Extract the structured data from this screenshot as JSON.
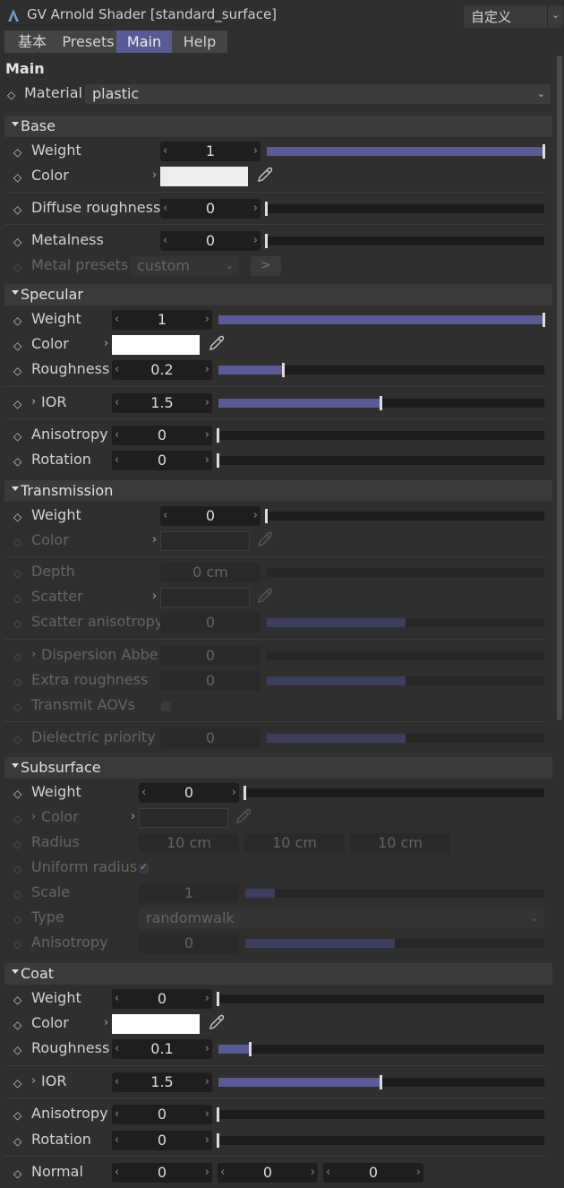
{
  "title": "GV Arnold Shader [standard_surface]",
  "preset": "自定义",
  "tabs": [
    "基本",
    "Presets",
    "Main",
    "Help"
  ],
  "main_heading": "Main",
  "material": {
    "label": "Material",
    "value": "plastic"
  },
  "base": {
    "header": "Base",
    "weight": {
      "label": "Weight",
      "value": "1",
      "level": 1.0
    },
    "color": {
      "label": "Color",
      "hex": "#eeeeee"
    },
    "diffuse_roughness": {
      "label": "Diffuse roughness",
      "value": "0",
      "level": 0.0
    },
    "metalness": {
      "label": "Metalness",
      "value": "0",
      "level": 0.0
    },
    "metal_presets": {
      "label": "Metal presets",
      "value": "custom",
      "button": ">"
    }
  },
  "specular": {
    "header": "Specular",
    "weight": {
      "label": "Weight",
      "value": "1",
      "level": 1.0
    },
    "color": {
      "label": "Color",
      "hex": "#ffffff"
    },
    "roughness": {
      "label": "Roughness",
      "value": "0.2",
      "level": 0.2
    },
    "ior": {
      "label": "IOR",
      "value": "1.5",
      "level": 0.5
    },
    "anisotropy": {
      "label": "Anisotropy",
      "value": "0",
      "level": 0.0
    },
    "rotation": {
      "label": "Rotation",
      "value": "0",
      "level": 0.0
    }
  },
  "transmission": {
    "header": "Transmission",
    "weight": {
      "label": "Weight",
      "value": "0",
      "level": 0.0
    },
    "color": {
      "label": "Color"
    },
    "depth": {
      "label": "Depth",
      "value": "0 cm",
      "level": 0.0
    },
    "scatter": {
      "label": "Scatter"
    },
    "scatter_anisotropy": {
      "label": "Scatter anisotropy",
      "value": "0",
      "level": 0.5
    },
    "dispersion_abbe": {
      "label": "Dispersion Abbe",
      "value": "0",
      "level": 0.0
    },
    "extra_roughness": {
      "label": "Extra roughness",
      "value": "0",
      "level": 0.5
    },
    "transmit_aovs": {
      "label": "Transmit AOVs",
      "checked": false
    },
    "dielectric_priority": {
      "label": "Dielectric priority",
      "value": "0",
      "level": 0.5
    }
  },
  "subsurface": {
    "header": "Subsurface",
    "weight": {
      "label": "Weight",
      "value": "0",
      "level": 0.0
    },
    "color": {
      "label": "Color"
    },
    "radius": {
      "label": "Radius",
      "values": [
        "10 cm",
        "10 cm",
        "10 cm"
      ]
    },
    "uniform_radius": {
      "label": "Uniform radius",
      "checked": true
    },
    "scale": {
      "label": "Scale",
      "value": "1",
      "level": 0.1
    },
    "type": {
      "label": "Type",
      "value": "randomwalk"
    },
    "anisotropy": {
      "label": "Anisotropy",
      "value": "0",
      "level": 0.5
    }
  },
  "coat": {
    "header": "Coat",
    "weight": {
      "label": "Weight",
      "value": "0",
      "level": 0.0
    },
    "color": {
      "label": "Color",
      "hex": "#ffffff"
    },
    "roughness": {
      "label": "Roughness",
      "value": "0.1",
      "level": 0.1
    },
    "ior": {
      "label": "IOR",
      "value": "1.5",
      "level": 0.5
    },
    "anisotropy": {
      "label": "Anisotropy",
      "value": "0",
      "level": 0.0
    },
    "rotation": {
      "label": "Rotation",
      "value": "0",
      "level": 0.0
    },
    "normal": {
      "label": "Normal",
      "values": [
        "0",
        "0",
        "0"
      ]
    }
  }
}
